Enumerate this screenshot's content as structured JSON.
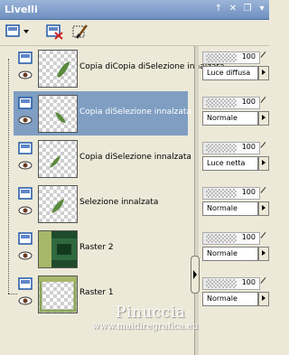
{
  "window": {
    "title": "Livelli"
  },
  "titlebar": {
    "pin": "↑",
    "close": "✕",
    "restore": "❐",
    "menu": "▾"
  },
  "layers": [
    {
      "name": "Copia diCopia diSelezione innalzata",
      "opacity": "100",
      "blend": "Luce diffusa",
      "selected": false,
      "thumb": "leaf"
    },
    {
      "name": "Copia diSelezione innalzata",
      "opacity": "100",
      "blend": "Normale",
      "selected": true,
      "thumb": "leaf"
    },
    {
      "name": "Copia diSelezione innalzata",
      "opacity": "100",
      "blend": "Luce netta",
      "selected": false,
      "thumb": "leaf"
    },
    {
      "name": "Selezione innalzata",
      "opacity": "100",
      "blend": "Normale",
      "selected": false,
      "thumb": "leaf"
    },
    {
      "name": "Raster 2",
      "opacity": "100",
      "blend": "Normale",
      "selected": false,
      "thumb": "green"
    },
    {
      "name": "Raster 1",
      "opacity": "100",
      "blend": "Normale",
      "selected": false,
      "thumb": "frame"
    }
  ],
  "watermark": {
    "line1": "Pinuccia",
    "line2": "www.maidiregrafica.eu"
  },
  "colors": {
    "selected_row": "#7f9ec2",
    "titlebar": "#6e8fbf",
    "leaf": "#5a8a3c"
  }
}
